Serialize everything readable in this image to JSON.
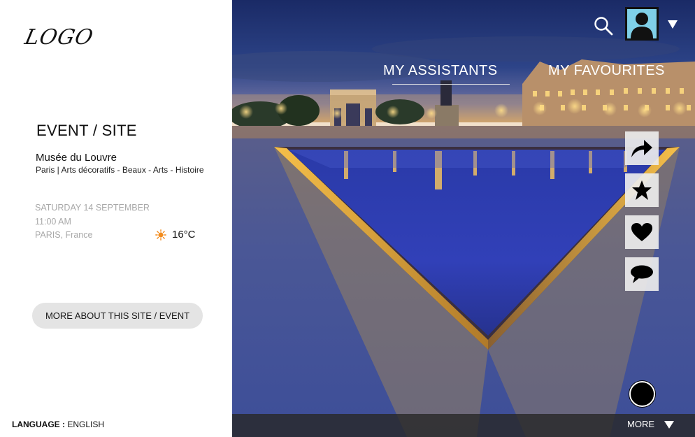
{
  "brand": {
    "logo_text": "LOGO"
  },
  "event": {
    "heading": "EVENT / SITE",
    "site_name": "Musée du Louvre",
    "tags": "Paris | Arts décoratifs - Beaux - Arts - Histoire",
    "date": "SATURDAY 14 SEPTEMBER",
    "time": "11:00 AM",
    "location": "PARIS, France",
    "temperature": "16°C",
    "weather_icon": "sun-icon",
    "more_button_label": "MORE ABOUT THIS SITE / EVENT"
  },
  "language": {
    "label": "LANGUAGE :",
    "value": "ENGLISH"
  },
  "header": {
    "search_icon": "search-icon",
    "avatar_icon": "user-avatar-icon",
    "dropdown_icon": "caret-down-icon"
  },
  "nav": {
    "tabs": [
      {
        "label": "MY ASSISTANTS",
        "active": true
      },
      {
        "label": "MY FAVOURITES",
        "active": false
      }
    ]
  },
  "actions": [
    {
      "name": "share",
      "icon": "share-arrow-icon"
    },
    {
      "name": "favorite",
      "icon": "star-icon"
    },
    {
      "name": "like",
      "icon": "heart-icon"
    },
    {
      "name": "comment",
      "icon": "speech-bubble-icon"
    }
  ],
  "footer": {
    "more_label": "MORE"
  },
  "colors": {
    "accent_sun": "#f28c1e",
    "sky": "#1c2d6e",
    "water": "#2d3fb0",
    "bar": "#282828"
  }
}
